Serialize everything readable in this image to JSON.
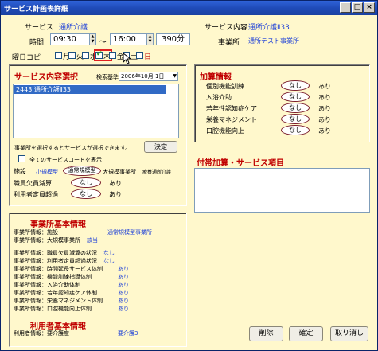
{
  "window": {
    "title": "サービス計画表詳細",
    "min_label": "_",
    "max_label": "□",
    "close_label": "×"
  },
  "header": {
    "service_label": "サービス",
    "service_value": "通所介護",
    "content_label": "サービス内容",
    "content_value": "通所介護Ⅱ33",
    "time_label": "時間",
    "time_start": "09:30",
    "time_tilde": "～",
    "time_end": "16:00",
    "duration": "390分",
    "office_label": "事業所",
    "office_value": "通所テスト事業所"
  },
  "weekday_copy": {
    "label": "曜日コピー",
    "days": [
      {
        "label": "月",
        "checked": false
      },
      {
        "label": "火",
        "checked": false
      },
      {
        "label": "水",
        "checked": false
      },
      {
        "label": "木",
        "checked": true
      },
      {
        "label": "金",
        "checked": false
      },
      {
        "label": "土",
        "checked": false
      },
      {
        "label": "日",
        "checked": false
      }
    ]
  },
  "service_select": {
    "title": "サービス内容選択",
    "search_label": "検索基準日",
    "search_date": "2006年10月 1日",
    "selected_item": "2443 通所介護Ⅱ33",
    "hint": "事業所を選択するとサービスが選択できます。",
    "decide_label": "決定",
    "show_all_label": "全てのサービスコードを表示",
    "facility_label": "施設",
    "facility_options": [
      "小規模型",
      "通常規模型",
      "大規模事業所",
      "療養通所介護"
    ],
    "facility_selected": "通常規模型",
    "staff_shortage_label": "職員欠員減算",
    "over_capacity_label": "利用者定員超過",
    "opt_none": "なし",
    "opt_yes": "あり"
  },
  "addon": {
    "title": "加算情報",
    "items": [
      {
        "label": "個別機能訓練",
        "value": "なし",
        "other": "あり"
      },
      {
        "label": "入浴介助",
        "value": "なし",
        "other": "あり"
      },
      {
        "label": "若年性認知症ケア",
        "value": "なし",
        "other": "あり"
      },
      {
        "label": "栄養マネジメント",
        "value": "なし",
        "other": "あり"
      },
      {
        "label": "口腔機能向上",
        "value": "なし",
        "other": "あり"
      }
    ]
  },
  "extra": {
    "title": "付帯加算・サービス項目"
  },
  "office_info": {
    "title": "事業所基本情報",
    "rows": [
      {
        "label": "事業所情報：施設",
        "value": "通常規模型事業所"
      },
      {
        "label": "事業所情報：大規模事業所",
        "value": "該当"
      },
      {
        "label": "事業所情報：職員欠員減算の状況",
        "value": "なし"
      },
      {
        "label": "事業所情報：利用者定員超過状況",
        "value": "なし"
      },
      {
        "label": "事業所情報：時間延長サービス体制",
        "value": "あり"
      },
      {
        "label": "事業所情報：機能訓練指導体制",
        "value": "あり"
      },
      {
        "label": "事業所情報：入浴介助体制",
        "value": "あり"
      },
      {
        "label": "事業所情報：若年認知症ケア体制",
        "value": "あり"
      },
      {
        "label": "事業所情報：栄養マネジメント体制",
        "value": "あり"
      },
      {
        "label": "事業所情報：口腔機能向上体制",
        "value": "あり"
      }
    ]
  },
  "user_info": {
    "title": "利用者基本情報",
    "row_label": "利用者情報：要介護度",
    "row_value": "要介護3"
  },
  "buttons": {
    "delete": "削除",
    "confirm": "確定",
    "cancel": "取り消し"
  }
}
